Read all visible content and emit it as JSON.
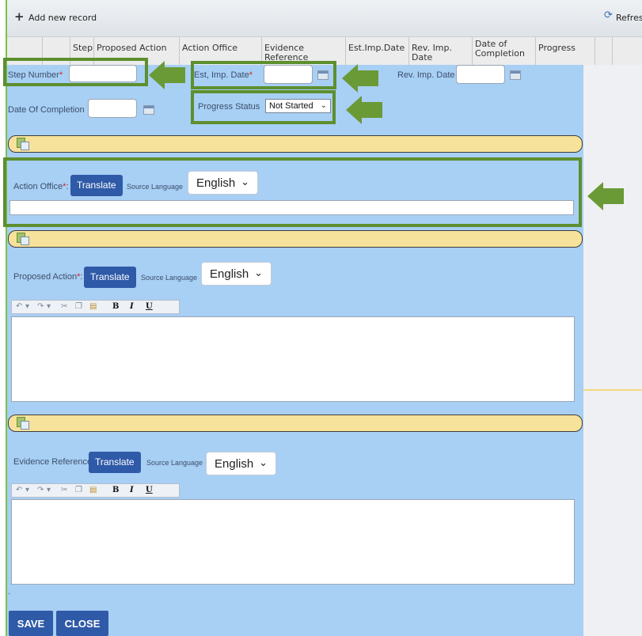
{
  "toolbar": {
    "add_label": "Add new record",
    "refresh_label": "Refresh"
  },
  "grid": {
    "columns": [
      "Step",
      "Proposed Action",
      "Action Office",
      "Evidence Reference",
      "Est.Imp.Date",
      "Rev. Imp. Date",
      "Date of Completion",
      "Progress"
    ]
  },
  "form": {
    "step_number_label": "Step Number",
    "required_mark": "*",
    "est_imp_label": "Est, Imp. Date",
    "rev_imp_label": "Rev. Imp. Date",
    "completion_label": "Date Of Completion",
    "progress_label": "Progress Status",
    "progress_value": "Not Started",
    "action_office_label": "Action Office",
    "proposed_action_label": "Proposed Action",
    "evidence_label": "Evidence Reference:",
    "translate_label": "Translate",
    "source_language_label": "Source Language",
    "language_value": "English",
    "colon": ":",
    "dot": "."
  },
  "editor_toolbar": {
    "undo": "↶",
    "redo": "↷",
    "dropdown": "▾",
    "cut": "✂",
    "copy": "❐",
    "paste": "▤",
    "bold": "B",
    "italic": "I",
    "underline": "U"
  },
  "buttons": {
    "save": "SAVE",
    "close": "CLOSE"
  },
  "colors": {
    "accent": "#2f5aa8",
    "form_bg": "#a8cff4",
    "highlight": "#5d8f2e",
    "section_bar": "#f6e29a"
  }
}
